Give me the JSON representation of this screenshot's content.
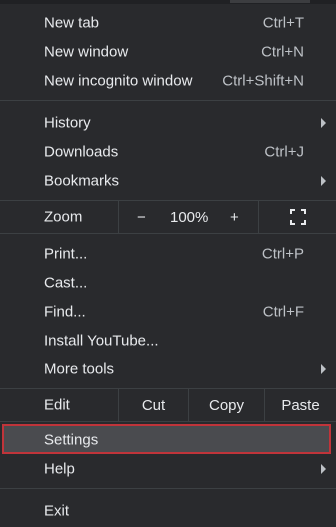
{
  "menu": {
    "new_tab": {
      "label": "New tab",
      "shortcut": "Ctrl+T"
    },
    "new_window": {
      "label": "New window",
      "shortcut": "Ctrl+N"
    },
    "new_incognito": {
      "label": "New incognito window",
      "shortcut": "Ctrl+Shift+N"
    },
    "history": {
      "label": "History"
    },
    "downloads": {
      "label": "Downloads",
      "shortcut": "Ctrl+J"
    },
    "bookmarks": {
      "label": "Bookmarks"
    },
    "zoom": {
      "label": "Zoom",
      "minus": "−",
      "value": "100%",
      "plus": "+"
    },
    "print": {
      "label": "Print...",
      "shortcut": "Ctrl+P"
    },
    "cast": {
      "label": "Cast..."
    },
    "find": {
      "label": "Find...",
      "shortcut": "Ctrl+F"
    },
    "install": {
      "label": "Install YouTube..."
    },
    "more_tools": {
      "label": "More tools"
    },
    "edit": {
      "label": "Edit",
      "cut": "Cut",
      "copy": "Copy",
      "paste": "Paste"
    },
    "settings": {
      "label": "Settings"
    },
    "help": {
      "label": "Help"
    },
    "exit": {
      "label": "Exit"
    }
  },
  "colors": {
    "background": "#292a2d",
    "text": "#e8eaed",
    "separator": "#3c4043",
    "highlight_border": "#c0343a",
    "highlight_fill": "#4a4b4f"
  },
  "icons": {
    "fullscreen": "fullscreen-icon",
    "submenu": "chevron-right-icon"
  }
}
